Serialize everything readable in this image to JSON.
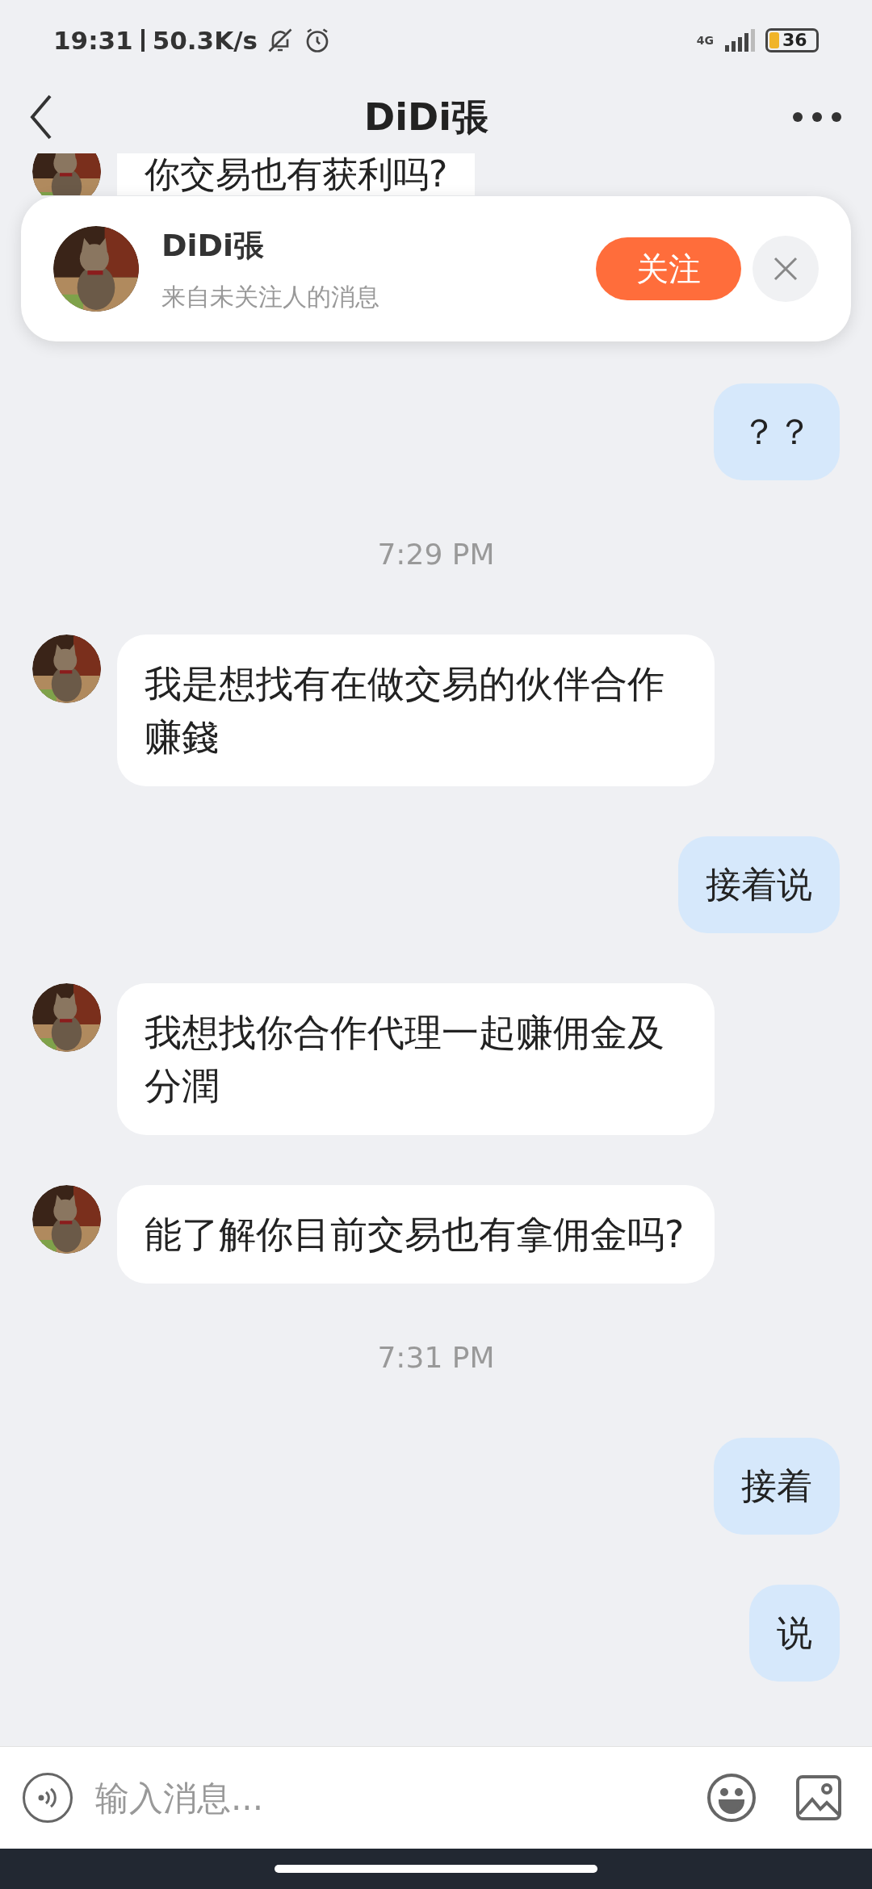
{
  "status_bar": {
    "time": "19:31",
    "speed": "50.3K/s",
    "network": "4G",
    "battery": "36"
  },
  "header": {
    "title": "DiDi張"
  },
  "partial_message": {
    "text": "你交易也有获利吗?"
  },
  "follow_banner": {
    "name": "DiDi張",
    "subtitle": "来自未关注人的消息",
    "follow_button": "关注"
  },
  "messages": [
    {
      "kind": "outgoing",
      "text": "？？"
    },
    {
      "kind": "time",
      "text": "7:29 PM"
    },
    {
      "kind": "incoming",
      "text": "我是想找有在做交易的伙伴合作赚錢"
    },
    {
      "kind": "outgoing",
      "text": "接着说"
    },
    {
      "kind": "incoming",
      "text": "我想找你合作代理一起赚佣金及分潤"
    },
    {
      "kind": "incoming",
      "text": "能了解你目前交易也有拿佣金吗?"
    },
    {
      "kind": "time",
      "text": "7:31 PM"
    },
    {
      "kind": "outgoing",
      "text": "接着"
    },
    {
      "kind": "outgoing",
      "text": "说"
    }
  ],
  "input_bar": {
    "placeholder": "输入消息..."
  }
}
